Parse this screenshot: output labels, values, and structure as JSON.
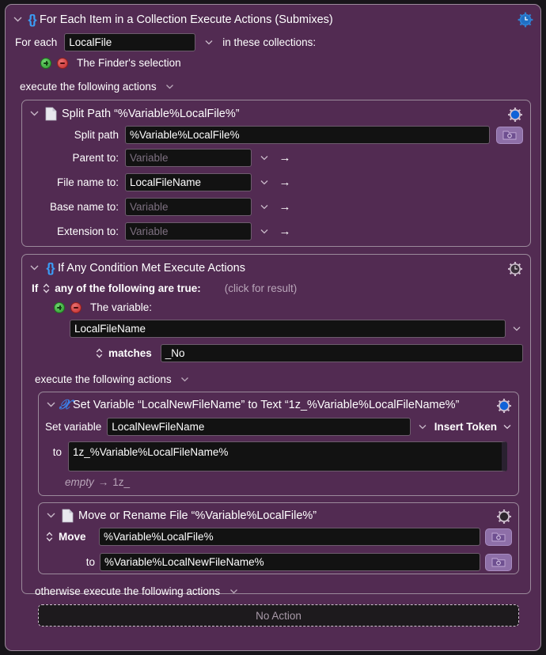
{
  "window": {
    "background_color": "#522B52",
    "field_color": "#121212"
  },
  "for_each": {
    "icon": "braces-icon",
    "title": "For Each Item in a Collection Execute Actions (Submixes)",
    "gear": "gear-clock-icon",
    "for_each_label": "For each",
    "variable_value": "LocalFile",
    "in_collections_label": "in these collections:",
    "add_icon": "plus-circle-icon",
    "remove_icon": "minus-circle-icon",
    "collection_source": "The Finder's selection",
    "execute_label": "execute the following actions"
  },
  "split_path": {
    "icon": "document-icon",
    "title": "Split Path “%Variable%LocalFile%”",
    "gear": "gear-blue-icon",
    "split_path_label": "Split path",
    "split_path_value": "%Variable%LocalFile%",
    "folder_button": "folder-gear-icon",
    "fields": [
      {
        "label": "Parent to:",
        "value": "Variable",
        "is_placeholder": true
      },
      {
        "label": "File name to:",
        "value": "LocalFileName",
        "is_placeholder": false
      },
      {
        "label": "Base name to:",
        "value": "Variable",
        "is_placeholder": true
      },
      {
        "label": "Extension to:",
        "value": "Variable",
        "is_placeholder": true
      }
    ]
  },
  "if_any": {
    "icon": "braces-icon",
    "title": "If Any Condition Met Execute Actions",
    "gear": "gear-clock-gray-icon",
    "if_label": "If",
    "condition_mode": "any of the following are true:",
    "click_for_result": "(click for result)",
    "add_icon": "plus-circle-icon",
    "remove_icon": "minus-circle-icon",
    "the_variable_label": "The variable:",
    "variable_name": "LocalFileName",
    "operator": "matches",
    "operand": "_No",
    "execute_label": "execute the following actions"
  },
  "set_variable": {
    "icon": "script-x-icon",
    "title": "Set Variable “LocalNewFileName” to Text “1z_%Variable%LocalFileName%”",
    "gear": "gear-blue-icon",
    "set_variable_label": "Set variable",
    "variable_name": "LocalNewFileName",
    "insert_token_label": "Insert Token",
    "to_label": "to",
    "to_value": "1z_%Variable%LocalFileName%",
    "preview_from": "empty",
    "preview_arrow": "→",
    "preview_to": "1z_"
  },
  "move_file": {
    "icon": "document-icon",
    "title": "Move or Rename File “%Variable%LocalFile%”",
    "gear": "gear-gray-icon",
    "move_label": "Move",
    "move_value": "%Variable%LocalFile%",
    "to_label": "to",
    "to_value": "%Variable%LocalNewFileName%",
    "folder_button": "folder-gear-icon"
  },
  "otherwise": {
    "label": "otherwise execute the following actions",
    "no_action": "No Action"
  }
}
